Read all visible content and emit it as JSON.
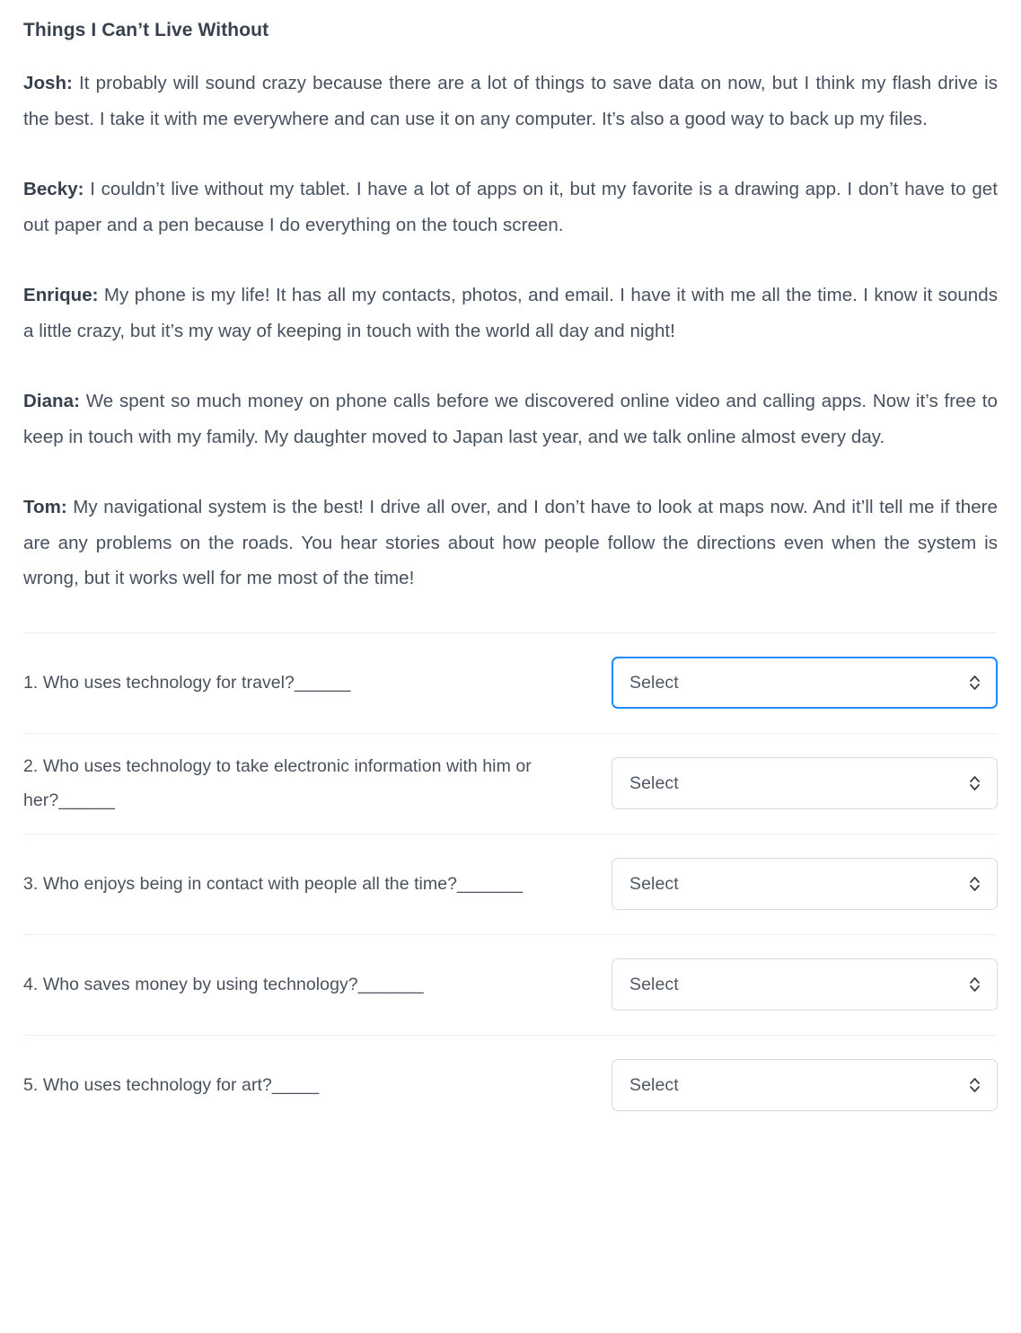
{
  "passage": {
    "title": "Things I Can’t Live Without",
    "paragraphs": [
      {
        "speaker": "Josh:",
        "text": " It probably will sound crazy because there are a lot of things to save data on now, but I think my flash drive is the best. I take it with me everywhere and can use it on any computer. It’s also a good way to back up my files."
      },
      {
        "speaker": "Becky:",
        "text": " I couldn’t live without my tablet. I have a lot of apps on it, but my favorite is a drawing app. I don’t have to get out paper and a pen because I do everything on the touch screen."
      },
      {
        "speaker": "Enrique:",
        "text": " My phone is my life! It has all my contacts, photos, and email. I have it with me all the time. I know it sounds a little crazy, but it’s my way of keeping in touch with the world all day and night!"
      },
      {
        "speaker": "Diana:",
        "text": " We spent so much money on phone calls before we discovered online video and calling apps. Now it’s free to keep in touch with my family. My daughter moved to Japan last year, and we talk online almost every day."
      },
      {
        "speaker": "Tom:",
        "text": " My navigational system is the best! I drive all over, and I don’t have to look at maps now. And it’ll tell me if there are any problems on the roads. You hear stories about how people follow the directions even when the system is wrong, but it works well for me most of the time!"
      }
    ]
  },
  "questions": [
    {
      "text": "1. Who uses technology for travel?",
      "blank": "______",
      "select_value": "Select",
      "focused": true
    },
    {
      "text": "2. Who uses technology to take electronic information with him or her?",
      "blank": "______",
      "select_value": "Select",
      "focused": false
    },
    {
      "text": "3. Who enjoys being in contact with people all the time?",
      "blank": "_______",
      "select_value": "Select",
      "focused": false
    },
    {
      "text": "4. Who saves money by using technology?",
      "blank": "_______",
      "select_value": "Select",
      "focused": false
    },
    {
      "text": "5. Who uses technology for art?",
      "blank": "_____",
      "select_value": "Select",
      "focused": false
    }
  ],
  "icons": {
    "dropdown": "chevron-up-down-icon"
  },
  "colors": {
    "focus_border": "#1a8cff",
    "text": "#46505e",
    "border": "#d8dbe0",
    "divider": "#eceef1"
  }
}
